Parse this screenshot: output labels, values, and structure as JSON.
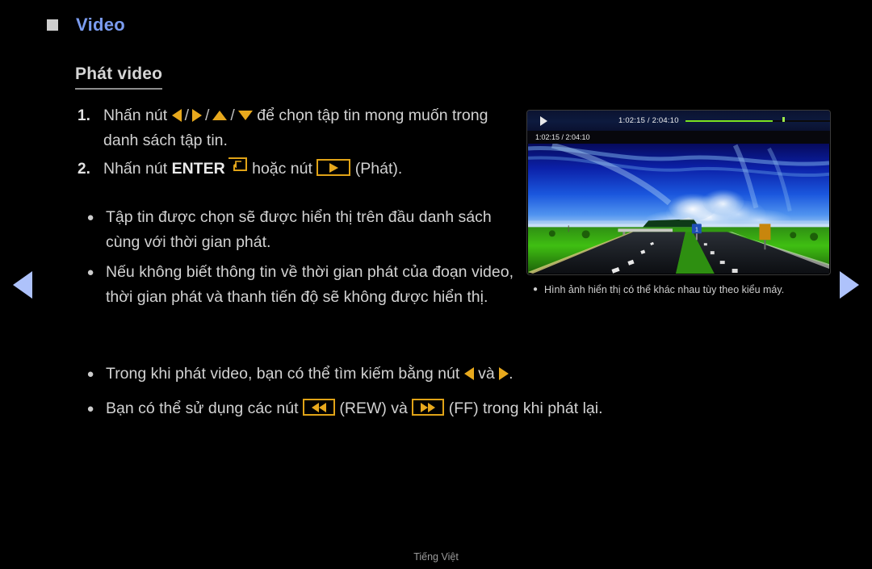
{
  "header": {
    "title": "Video",
    "bullet_icon": "square-icon"
  },
  "section": {
    "heading": "Phát video"
  },
  "steps": [
    {
      "number": "1.",
      "text_before": "Nhấn nút",
      "icons": [
        "arrow-left-icon",
        "arrow-right-icon",
        "arrow-up-icon",
        "arrow-down-icon"
      ],
      "text_after": "để chọn tập tin mong muốn trong danh sách tập tin."
    },
    {
      "number": "2.",
      "text_before": "Nhấn nút",
      "bold_label": "ENTER",
      "enter_icon": "enter-key-icon",
      "text_middle": "hoặc nút",
      "play_icon": "play-button-icon",
      "text_after": "(Phát)."
    }
  ],
  "bullets": [
    {
      "text": "Tập tin được chọn sẽ được hiển thị trên đầu danh sách cùng với thời gian phát."
    },
    {
      "text": "Nếu không biết thông tin về thời gian phát của đoạn video, thời gian phát và thanh tiến độ sẽ không được hiển thị."
    }
  ],
  "wide_bullets": [
    {
      "text_before": "Trong khi phát video, bạn có thể tìm kiếm bằng nút",
      "icon_left": "arrow-left-icon",
      "text_middle": "và",
      "icon_right": "arrow-right-icon",
      "text_after": "."
    },
    {
      "text_before": "Bạn có thể sử dụng các nút",
      "icon_rew": "rewind-button-icon",
      "label_rew": "(REW)",
      "text_middle": "và",
      "icon_ff": "fast-forward-button-icon",
      "label_ff": "(FF)",
      "text_after": "trong khi phát lại."
    }
  ],
  "preview": {
    "osd": {
      "play_icon": "play-icon",
      "time": "1:02:15 / 2:04:10",
      "time_secondary": "1:02:15 / 2:04:10",
      "progress_percent": 50,
      "progress_color": "#7ae020"
    },
    "image_description": "highway-landscape-photo",
    "caption": "Hình ảnh hiển thị có thể khác nhau tùy theo kiểu máy."
  },
  "navigation": {
    "prev_icon": "nav-prev-arrow-icon",
    "next_icon": "nav-next-arrow-icon",
    "arrow_color": "#aec2fb"
  },
  "footer": {
    "language": "Tiếng Việt"
  }
}
